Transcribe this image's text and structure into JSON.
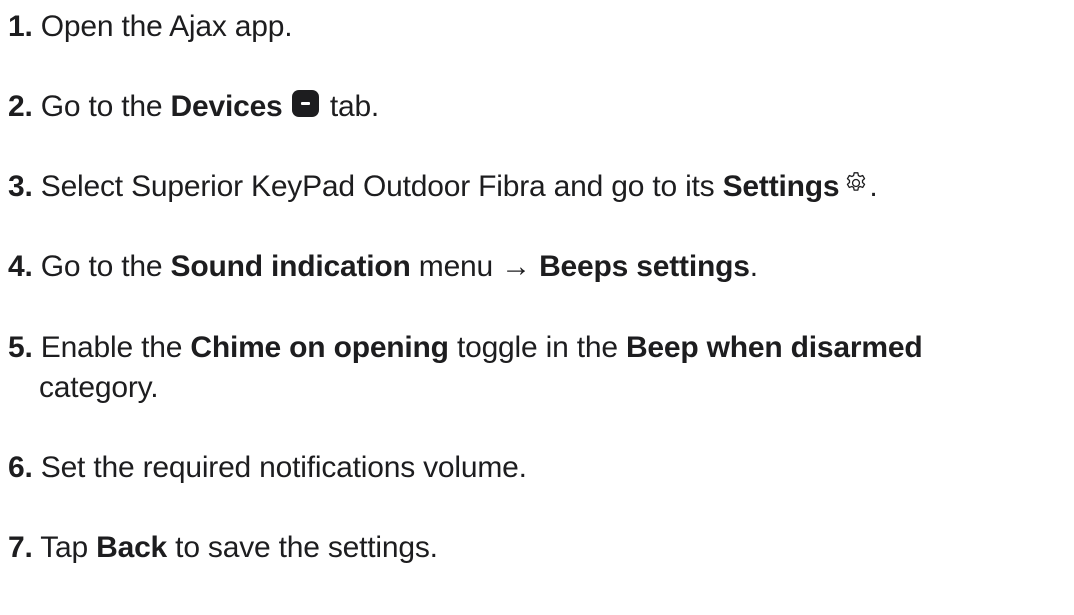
{
  "steps": [
    {
      "num": "1.",
      "t1": "Open the Ajax app."
    },
    {
      "num": "2.",
      "t1": "Go to the ",
      "b1": "Devices",
      "t2": " tab.",
      "icon": "devices-tab-icon"
    },
    {
      "num": "3.",
      "t1": "Select Superior KeyPad Outdoor Fibra and go to its ",
      "b1": "Settings",
      "t2": ".",
      "icon": "gear-icon"
    },
    {
      "num": "4.",
      "t1": "Go to the ",
      "b1": "Sound indication",
      "t2": " menu → ",
      "b2": "Beeps settings",
      "t3": "."
    },
    {
      "num": "5.",
      "t1": "Enable the ",
      "b1": "Chime on opening",
      "t2": " toggle in the ",
      "b2": "Beep when disarmed",
      "t3": "category."
    },
    {
      "num": "6.",
      "t1": "Set the required notifications volume."
    },
    {
      "num": "7.",
      "t1": "Tap ",
      "b1": "Back",
      "t2": " to save the settings."
    }
  ]
}
